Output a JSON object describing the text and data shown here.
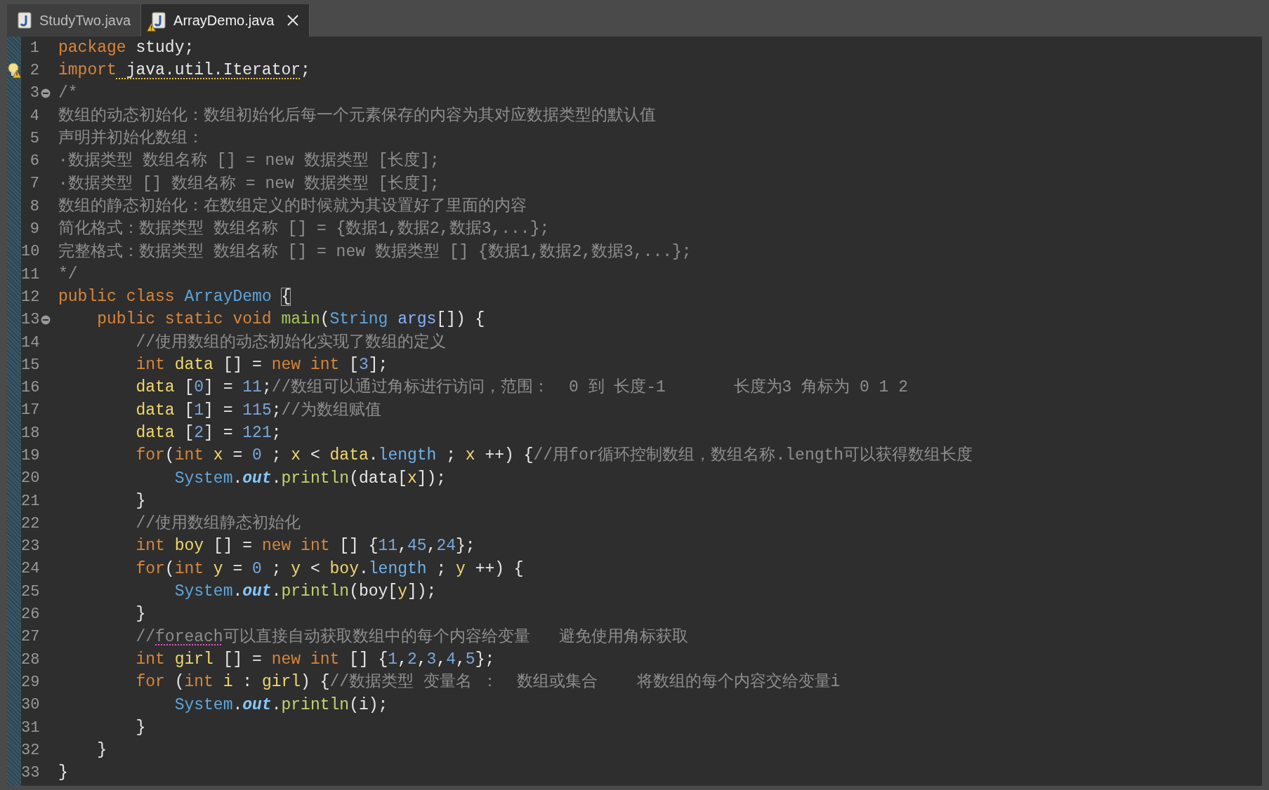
{
  "tabs": [
    {
      "label": "StudyTwo.java",
      "selected": false,
      "warning": false,
      "closable": false
    },
    {
      "label": "ArrayDemo.java",
      "selected": true,
      "warning": true,
      "closable": true
    }
  ],
  "editor": {
    "lines": [
      {
        "number": "1",
        "fold": false,
        "warning": false,
        "tokens": [
          {
            "kind": "keyword",
            "text": "package"
          },
          {
            "kind": "plain",
            "text": " study;"
          }
        ]
      },
      {
        "number": "2",
        "fold": false,
        "warning": true,
        "tokens": [
          {
            "kind": "keyword",
            "text": "import"
          },
          {
            "kind": "warning_text",
            "text": " java.util.Iterator"
          },
          {
            "kind": "plain",
            "text": ";"
          }
        ]
      },
      {
        "number": "3",
        "fold": true,
        "warning": false,
        "tokens": [
          {
            "kind": "comment",
            "text": "/*"
          }
        ]
      },
      {
        "number": "4",
        "fold": false,
        "warning": false,
        "tokens": [
          {
            "kind": "comment",
            "text": "数组的动态初始化：数组初始化后每一个元素保存的内容为其对应数据类型的默认值"
          }
        ]
      },
      {
        "number": "5",
        "fold": false,
        "warning": false,
        "tokens": [
          {
            "kind": "comment",
            "text": "声明并初始化数组："
          }
        ]
      },
      {
        "number": "6",
        "fold": false,
        "warning": false,
        "tokens": [
          {
            "kind": "comment",
            "text": "·数据类型 数组名称 [] = new 数据类型 [长度];"
          }
        ]
      },
      {
        "number": "7",
        "fold": false,
        "warning": false,
        "tokens": [
          {
            "kind": "comment",
            "text": "·数据类型 [] 数组名称 = new 数据类型 [长度];"
          }
        ]
      },
      {
        "number": "8",
        "fold": false,
        "warning": false,
        "tokens": [
          {
            "kind": "comment",
            "text": "数组的静态初始化：在数组定义的时候就为其设置好了里面的内容"
          }
        ]
      },
      {
        "number": "9",
        "fold": false,
        "warning": false,
        "tokens": [
          {
            "kind": "comment",
            "text": "简化格式：数据类型 数组名称 [] = {数据1,数据2,数据3,...};"
          }
        ]
      },
      {
        "number": "10",
        "fold": false,
        "warning": false,
        "tokens": [
          {
            "kind": "comment",
            "text": "完整格式：数据类型 数组名称 [] = new 数据类型 [] {数据1,数据2,数据3,...};"
          }
        ]
      },
      {
        "number": "11",
        "fold": false,
        "warning": false,
        "tokens": [
          {
            "kind": "comment",
            "text": "*/"
          }
        ]
      },
      {
        "number": "12",
        "fold": false,
        "warning": false,
        "tokens": [
          {
            "kind": "keyword",
            "text": "public"
          },
          {
            "kind": "keyword",
            "text": " class"
          },
          {
            "kind": "type",
            "text": " ArrayDemo "
          },
          {
            "kind": "bracket_match",
            "text": "{"
          }
        ]
      },
      {
        "number": "13",
        "fold": true,
        "warning": false,
        "tokens": [
          {
            "kind": "keyword",
            "text": "    public"
          },
          {
            "kind": "keyword",
            "text": " static"
          },
          {
            "kind": "keyword",
            "text": " void"
          },
          {
            "kind": "method",
            "text": " main"
          },
          {
            "kind": "plain",
            "text": "("
          },
          {
            "kind": "type",
            "text": "String"
          },
          {
            "kind": "param",
            "text": " args"
          },
          {
            "kind": "plain",
            "text": "[]) {"
          }
        ]
      },
      {
        "number": "14",
        "fold": false,
        "warning": false,
        "tokens": [
          {
            "kind": "comment",
            "text": "        //使用数组的动态初始化实现了数组的定义"
          }
        ]
      },
      {
        "number": "15",
        "fold": false,
        "warning": false,
        "tokens": [
          {
            "kind": "keyword",
            "text": "        int"
          },
          {
            "kind": "local",
            "text": " data"
          },
          {
            "kind": "plain",
            "text": " [] = "
          },
          {
            "kind": "keyword",
            "text": "new"
          },
          {
            "kind": "keyword",
            "text": " int"
          },
          {
            "kind": "plain",
            "text": " ["
          },
          {
            "kind": "number",
            "text": "3"
          },
          {
            "kind": "plain",
            "text": "];"
          }
        ]
      },
      {
        "number": "16",
        "fold": false,
        "warning": false,
        "tokens": [
          {
            "kind": "local",
            "text": "        data"
          },
          {
            "kind": "plain",
            "text": " ["
          },
          {
            "kind": "number",
            "text": "0"
          },
          {
            "kind": "plain",
            "text": "] = "
          },
          {
            "kind": "number",
            "text": "11"
          },
          {
            "kind": "plain",
            "text": ";"
          },
          {
            "kind": "comment",
            "text": "//数组可以通过角标进行访问，范围：  0 到 长度-1       长度为3 角标为 0 1 2"
          }
        ]
      },
      {
        "number": "17",
        "fold": false,
        "warning": false,
        "tokens": [
          {
            "kind": "local",
            "text": "        data"
          },
          {
            "kind": "plain",
            "text": " ["
          },
          {
            "kind": "number",
            "text": "1"
          },
          {
            "kind": "plain",
            "text": "] = "
          },
          {
            "kind": "number",
            "text": "115"
          },
          {
            "kind": "plain",
            "text": ";"
          },
          {
            "kind": "comment",
            "text": "//为数组赋值"
          }
        ]
      },
      {
        "number": "18",
        "fold": false,
        "warning": false,
        "tokens": [
          {
            "kind": "local",
            "text": "        data"
          },
          {
            "kind": "plain",
            "text": " ["
          },
          {
            "kind": "number",
            "text": "2"
          },
          {
            "kind": "plain",
            "text": "] = "
          },
          {
            "kind": "number",
            "text": "121"
          },
          {
            "kind": "plain",
            "text": ";"
          }
        ]
      },
      {
        "number": "19",
        "fold": false,
        "warning": false,
        "tokens": [
          {
            "kind": "keyword",
            "text": "        for"
          },
          {
            "kind": "plain",
            "text": "("
          },
          {
            "kind": "keyword",
            "text": "int"
          },
          {
            "kind": "local",
            "text": " x"
          },
          {
            "kind": "plain",
            "text": " = "
          },
          {
            "kind": "number",
            "text": "0"
          },
          {
            "kind": "plain",
            "text": " ; "
          },
          {
            "kind": "local",
            "text": "x"
          },
          {
            "kind": "plain",
            "text": " < "
          },
          {
            "kind": "local",
            "text": "data"
          },
          {
            "kind": "plain",
            "text": "."
          },
          {
            "kind": "field",
            "text": "length"
          },
          {
            "kind": "plain",
            "text": " ; "
          },
          {
            "kind": "local",
            "text": "x"
          },
          {
            "kind": "plain",
            "text": " ++) {"
          },
          {
            "kind": "comment",
            "text": "//用for循环控制数组，数组名称.length可以获得数组长度"
          }
        ]
      },
      {
        "number": "20",
        "fold": false,
        "warning": false,
        "tokens": [
          {
            "kind": "type",
            "text": "            System"
          },
          {
            "kind": "plain",
            "text": "."
          },
          {
            "kind": "static_field",
            "text": "out"
          },
          {
            "kind": "plain",
            "text": "."
          },
          {
            "kind": "method_call",
            "text": "println"
          },
          {
            "kind": "plain",
            "text": "(data["
          },
          {
            "kind": "local",
            "text": "x"
          },
          {
            "kind": "plain",
            "text": "]);"
          }
        ]
      },
      {
        "number": "21",
        "fold": false,
        "warning": false,
        "tokens": [
          {
            "kind": "plain",
            "text": "        }"
          }
        ]
      },
      {
        "number": "22",
        "fold": false,
        "warning": false,
        "tokens": [
          {
            "kind": "comment",
            "text": "        //使用数组静态初始化"
          }
        ]
      },
      {
        "number": "23",
        "fold": false,
        "warning": false,
        "tokens": [
          {
            "kind": "keyword",
            "text": "        int"
          },
          {
            "kind": "local",
            "text": " boy"
          },
          {
            "kind": "plain",
            "text": " [] = "
          },
          {
            "kind": "keyword",
            "text": "new"
          },
          {
            "kind": "keyword",
            "text": " int"
          },
          {
            "kind": "plain",
            "text": " [] {"
          },
          {
            "kind": "number",
            "text": "11"
          },
          {
            "kind": "plain",
            "text": ","
          },
          {
            "kind": "number",
            "text": "45"
          },
          {
            "kind": "plain",
            "text": ","
          },
          {
            "kind": "number",
            "text": "24"
          },
          {
            "kind": "plain",
            "text": "};"
          }
        ]
      },
      {
        "number": "24",
        "fold": false,
        "warning": false,
        "tokens": [
          {
            "kind": "keyword",
            "text": "        for"
          },
          {
            "kind": "plain",
            "text": "("
          },
          {
            "kind": "keyword",
            "text": "int"
          },
          {
            "kind": "local",
            "text": " y"
          },
          {
            "kind": "plain",
            "text": " = "
          },
          {
            "kind": "number",
            "text": "0"
          },
          {
            "kind": "plain",
            "text": " ; "
          },
          {
            "kind": "local",
            "text": "y"
          },
          {
            "kind": "plain",
            "text": " < "
          },
          {
            "kind": "local",
            "text": "boy"
          },
          {
            "kind": "plain",
            "text": "."
          },
          {
            "kind": "field",
            "text": "length"
          },
          {
            "kind": "plain",
            "text": " ; "
          },
          {
            "kind": "local",
            "text": "y"
          },
          {
            "kind": "plain",
            "text": " ++) {"
          }
        ]
      },
      {
        "number": "25",
        "fold": false,
        "warning": false,
        "tokens": [
          {
            "kind": "type",
            "text": "            System"
          },
          {
            "kind": "plain",
            "text": "."
          },
          {
            "kind": "static_field",
            "text": "out"
          },
          {
            "kind": "plain",
            "text": "."
          },
          {
            "kind": "method_call",
            "text": "println"
          },
          {
            "kind": "plain",
            "text": "(boy["
          },
          {
            "kind": "local",
            "text": "y"
          },
          {
            "kind": "plain",
            "text": "]);"
          }
        ]
      },
      {
        "number": "26",
        "fold": false,
        "warning": false,
        "tokens": [
          {
            "kind": "plain",
            "text": "        }"
          }
        ]
      },
      {
        "number": "27",
        "fold": false,
        "warning": false,
        "tokens": [
          {
            "kind": "comment",
            "text": "        //"
          },
          {
            "kind": "spelling_text",
            "text": "foreach"
          },
          {
            "kind": "comment",
            "text": "可以直接自动获取数组中的每个内容给变量   避免使用角标获取"
          }
        ]
      },
      {
        "number": "28",
        "fold": false,
        "warning": false,
        "tokens": [
          {
            "kind": "keyword",
            "text": "        int"
          },
          {
            "kind": "local",
            "text": " girl"
          },
          {
            "kind": "plain",
            "text": " [] = "
          },
          {
            "kind": "keyword",
            "text": "new"
          },
          {
            "kind": "keyword",
            "text": " int"
          },
          {
            "kind": "plain",
            "text": " [] {"
          },
          {
            "kind": "number",
            "text": "1"
          },
          {
            "kind": "plain",
            "text": ","
          },
          {
            "kind": "number",
            "text": "2"
          },
          {
            "kind": "plain",
            "text": ","
          },
          {
            "kind": "number",
            "text": "3"
          },
          {
            "kind": "plain",
            "text": ","
          },
          {
            "kind": "number",
            "text": "4"
          },
          {
            "kind": "plain",
            "text": ","
          },
          {
            "kind": "number",
            "text": "5"
          },
          {
            "kind": "plain",
            "text": "};"
          }
        ]
      },
      {
        "number": "29",
        "fold": false,
        "warning": false,
        "tokens": [
          {
            "kind": "keyword",
            "text": "        for"
          },
          {
            "kind": "plain",
            "text": " ("
          },
          {
            "kind": "keyword",
            "text": "int"
          },
          {
            "kind": "local",
            "text": " i"
          },
          {
            "kind": "plain",
            "text": " : "
          },
          {
            "kind": "local",
            "text": "girl"
          },
          {
            "kind": "plain",
            "text": ") {"
          },
          {
            "kind": "comment",
            "text": "//数据类型 变量名 ：  数组或集合    将数组的每个内容交给变量i"
          }
        ]
      },
      {
        "number": "30",
        "fold": false,
        "warning": false,
        "tokens": [
          {
            "kind": "type",
            "text": "            System"
          },
          {
            "kind": "plain",
            "text": "."
          },
          {
            "kind": "static_field",
            "text": "out"
          },
          {
            "kind": "plain",
            "text": "."
          },
          {
            "kind": "method_call",
            "text": "println"
          },
          {
            "kind": "plain",
            "text": "(i);"
          }
        ]
      },
      {
        "number": "31",
        "fold": false,
        "warning": false,
        "tokens": [
          {
            "kind": "plain",
            "text": "        }"
          }
        ]
      },
      {
        "number": "32",
        "fold": false,
        "warning": false,
        "tokens": [
          {
            "kind": "plain",
            "text": "    }"
          }
        ]
      },
      {
        "number": "33",
        "fold": false,
        "warning": false,
        "tokens": [
          {
            "kind": "plain",
            "text": "}"
          }
        ]
      }
    ]
  }
}
